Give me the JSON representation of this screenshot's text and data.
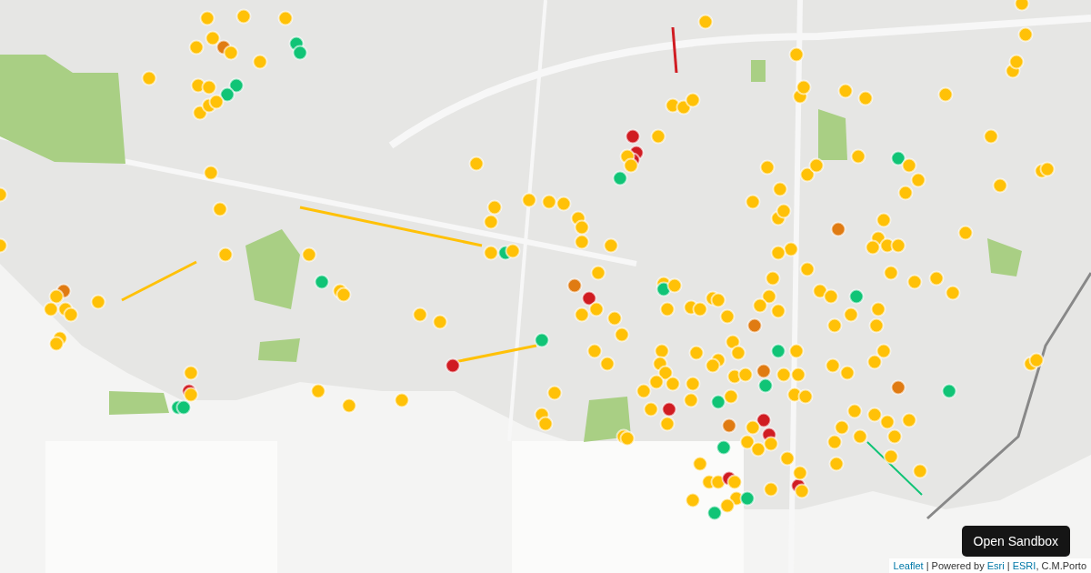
{
  "map": {
    "attribution": [
      {
        "kind": "link",
        "text": "Leaflet"
      },
      {
        "kind": "text",
        "text": " | Powered by "
      },
      {
        "kind": "link",
        "text": "Esri"
      },
      {
        "kind": "text",
        "text": " | "
      },
      {
        "kind": "link",
        "text": "ESRI"
      },
      {
        "kind": "text",
        "text": ", C.M.Porto"
      }
    ]
  },
  "sandbox_button": {
    "label": "Open Sandbox"
  }
}
